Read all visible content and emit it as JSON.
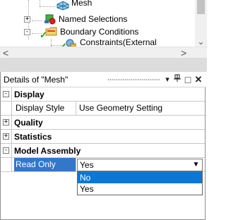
{
  "tree": {
    "nodes": [
      {
        "label": "Mesh"
      },
      {
        "label": "Named Selections",
        "expander": "+"
      },
      {
        "label": "Boundary Conditions",
        "expander": "-"
      },
      {
        "label": "Constraints(External"
      }
    ],
    "hscroll_left_glyph": "<",
    "hscroll_right_glyph": ">",
    "vscroll_down_glyph": "⌄"
  },
  "details": {
    "title": "Details of \"Mesh\"",
    "header_buttons": {
      "menu": "▾",
      "pin": "⊥",
      "maximize": "□",
      "close": "✕"
    },
    "groups": [
      {
        "title": "Display",
        "expander": "-"
      },
      {
        "title": "Quality",
        "expander": "+"
      },
      {
        "title": "Statistics",
        "expander": "+"
      },
      {
        "title": "Model Assembly",
        "expander": "-"
      }
    ],
    "properties": [
      {
        "name": "Display Style",
        "value": "Use Geometry Setting"
      },
      {
        "name": "Read Only",
        "value": "Yes"
      }
    ],
    "dropdown": {
      "button_glyph": "▼",
      "options": [
        "No",
        "Yes"
      ],
      "highlighted": "No"
    }
  },
  "colors": {
    "selection_blue": "#3277c8",
    "dropdown_highlight": "#0b78d7",
    "check_green": "#21a021",
    "folder_yellow": "#e8b923",
    "grid_line": "#c8c8c8"
  },
  "icons": [
    "mesh-icon",
    "named-selections-icon",
    "boundary-conditions-folder-icon",
    "constraints-icon",
    "check-icon",
    "pin-icon",
    "maximize-icon",
    "close-icon",
    "menu-arrow-icon"
  ]
}
